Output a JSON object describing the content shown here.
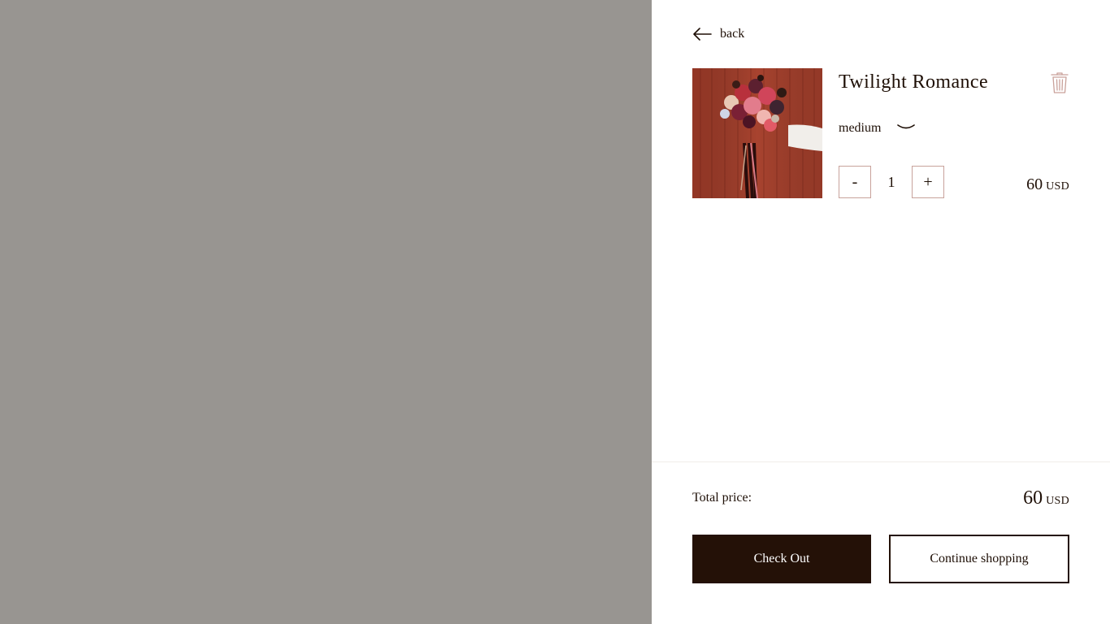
{
  "nav": {
    "back_label": "back",
    "back_icon": "arrow-left-icon"
  },
  "cart": {
    "items": [
      {
        "title": "Twilight Romance",
        "size": "medium",
        "quantity": "1",
        "price": "60",
        "currency": "USD",
        "decrement_label": "-",
        "increment_label": "+",
        "icons": {
          "remove": "trash-icon",
          "size_toggle": "chevron-down-icon"
        }
      }
    ],
    "total_label": "Total price:",
    "total_price": "60",
    "total_currency": "USD",
    "checkout_label": "Check Out",
    "continue_label": "Continue shopping"
  },
  "colors": {
    "overlay": "#989591",
    "text": "#1e0f06",
    "button_dark": "#241107",
    "stepper_border": "#c8a29b",
    "trash_icon": "#c9a19a"
  }
}
